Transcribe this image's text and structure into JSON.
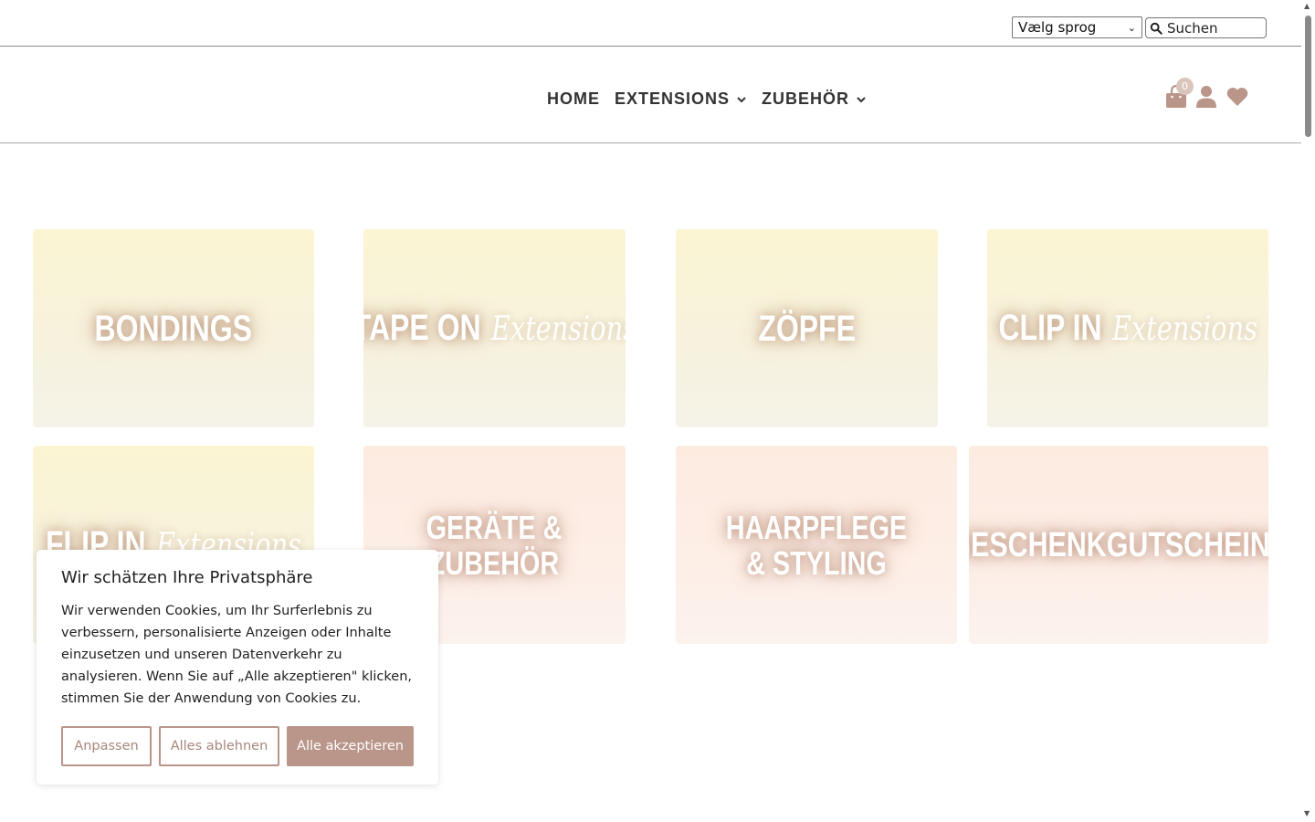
{
  "topbar": {
    "language_select": "Vælg sprog",
    "search_placeholder": "Suchen"
  },
  "nav": {
    "items": [
      {
        "label": "HOME",
        "has_dropdown": false
      },
      {
        "label": "EXTENSIONS",
        "has_dropdown": true
      },
      {
        "label": "ZUBEHÖR",
        "has_dropdown": true
      }
    ]
  },
  "header_icons": {
    "cart_count": "0",
    "icons": [
      "shopping-bag-icon",
      "user-icon",
      "heart-icon"
    ],
    "icon_color": "#b9958a"
  },
  "tiles": [
    {
      "title": "BONDINGS",
      "script": ""
    },
    {
      "title": "TAPE ON",
      "script": "Extensions"
    },
    {
      "title": "ZÖPFE",
      "script": ""
    },
    {
      "title": "CLIP IN",
      "script": "Extensions"
    },
    {
      "title": "FLIP IN",
      "script": "Extensions"
    },
    {
      "title_line1": "GERÄTE &",
      "title_line2": "ZUBEHÖR"
    },
    {
      "title_line1": "HAARPFLEGE",
      "title_line2": "& STYLING"
    },
    {
      "title": "GESCHENKGUTSCHEINE",
      "script": ""
    }
  ],
  "cookie_banner": {
    "title": "Wir schätzen Ihre Privatsphäre",
    "text": "Wir verwenden Cookies, um Ihr Surferlebnis zu verbessern, personalisierte Anzeigen oder Inhalte einzusetzen und unseren Datenverkehr zu analysieren. Wenn Sie auf „Alle akzeptieren\" klicken, stimmen Sie der Anwendung von Cookies zu.",
    "btn_customize": "Anpassen",
    "btn_reject": "Alles ablehnen",
    "btn_accept": "Alle akzeptieren",
    "accent_color": "#b9958a"
  }
}
